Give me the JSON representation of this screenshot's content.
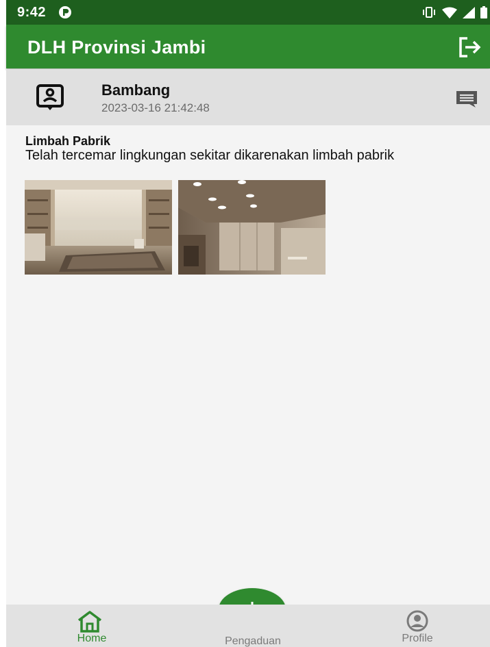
{
  "status_bar": {
    "time": "9:42"
  },
  "app_bar": {
    "title": "DLH Provinsi Jambi",
    "logout_icon": "logout-icon"
  },
  "post": {
    "author": "Bambang",
    "date": "2023-03-16 21:42:48",
    "title": "Limbah Pabrik",
    "description": "Telah tercemar lingkungan sekitar dikarenakan limbah pabrik",
    "images": [
      "living-room-photo",
      "room-interior-photo"
    ]
  },
  "bottom_nav": {
    "home_label": "Home",
    "pengaduan_label": "Pengaduan",
    "profile_label": "Profile"
  },
  "colors": {
    "primary": "#2f8a2f",
    "status_bar": "#1e5f1e",
    "header_bg": "#e0e0e0",
    "nav_bg": "#e2e2e2"
  }
}
